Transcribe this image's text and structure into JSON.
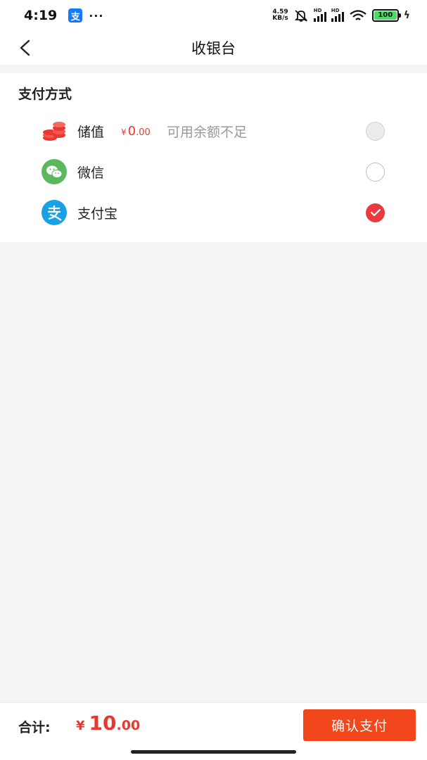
{
  "status_bar": {
    "time": "4:19",
    "app_badge": "支",
    "more": "···",
    "net_speed_value": "4.59",
    "net_speed_unit": "KB/s",
    "sim1_label": "HD",
    "sim2_label": "HD",
    "battery": "100",
    "icons": [
      "alipay-icon",
      "bell-off-icon",
      "signal-icon",
      "wifi-icon",
      "battery-icon",
      "charging-icon"
    ]
  },
  "nav": {
    "title": "收银台",
    "back_icon": "chevron-left-icon"
  },
  "payment": {
    "section_title": "支付方式",
    "options": [
      {
        "label": "储值",
        "icon": "coins-icon",
        "balance_currency": "¥",
        "balance_int": "0",
        "balance_dec": ".00",
        "note": "可用余额不足",
        "state": "disabled"
      },
      {
        "label": "微信",
        "icon": "wechat-icon",
        "state": "unchecked"
      },
      {
        "label": "支付宝",
        "icon": "alipay-icon",
        "state": "checked"
      }
    ]
  },
  "footer": {
    "total_label": "合计:",
    "total_currency": "¥",
    "total_int": "10",
    "total_dec": ".00",
    "confirm_label": "确认支付"
  },
  "colors": {
    "accent_red": "#e8382f",
    "confirm_orange": "#f2471c",
    "check_red": "#ea3a3f",
    "wechat_green": "#5bb85d",
    "alipay_blue": "#1aa0e5",
    "background": "#f4f4f4"
  }
}
